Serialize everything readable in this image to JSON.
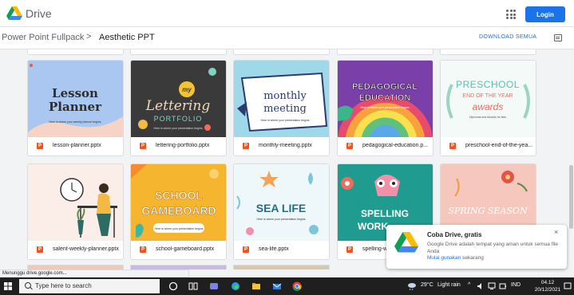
{
  "header": {
    "brand": "Drive",
    "login_label": "Login"
  },
  "breadcrumb": {
    "parent": "Power Point Fullpack",
    "separator": ">",
    "current": "Aesthetic PPT",
    "download_all": "DOWNLOAD SEMUA"
  },
  "files": [
    {
      "name": "lesson-planner.pptx",
      "thumb": {
        "title": [
          "Lesson",
          "Planner"
        ],
        "sub": "Here is where your weekly planner begins"
      }
    },
    {
      "name": "lettering-portfolio.pptx",
      "thumb": {
        "badge": "my",
        "title": [
          "Lettering"
        ],
        "sub2": "PORTFOLIO",
        "sub": "Here is where your presentation begins"
      }
    },
    {
      "name": "monthly-meeting.pptx",
      "thumb": {
        "title": [
          "monthly",
          "meeting"
        ],
        "sub": "Here is where your presentation begins"
      }
    },
    {
      "name": "pedagogical-education.p...",
      "thumb": {
        "title": [
          "PEDAGOGICAL",
          "EDUCATION"
        ],
        "sub": "Here is where your presentation begins"
      }
    },
    {
      "name": "preschool-end-of-the-yea...",
      "thumb": {
        "title": [
          "PRESCHOOL",
          "END OF THE YEAR",
          "awards"
        ],
        "sub": "Diplomas and Awards for kids"
      }
    },
    {
      "name": "salent-weekly-planner.pptx",
      "thumb": {}
    },
    {
      "name": "school-gameboard.pptx",
      "thumb": {
        "title": [
          "SCHOOL",
          "GAMEBOARD"
        ],
        "sub": "Here is where your presentation begins"
      }
    },
    {
      "name": "sea-life.pptx",
      "thumb": {
        "title": [
          "SEA LIFE"
        ],
        "sub": "Here is where your presentation begins"
      }
    },
    {
      "name": "spelling-w...",
      "thumb": {
        "title": [
          "SPELLING",
          "WORK"
        ]
      }
    },
    {
      "name": "",
      "thumb": {
        "title": [
          "SPRING SEASON"
        ]
      }
    }
  ],
  "file_icon_letter": "P",
  "toast": {
    "title": "Coba Drive, gratis",
    "body": "Google Drive adalah tempat yang aman untuk semua file Anda",
    "link": "Mulai gunakan",
    "link_tail": " sekarang",
    "close": "×"
  },
  "status_text": "Menunggu drive.google.com...",
  "taskbar": {
    "search_placeholder": "Type here to search",
    "temperature": "29°C",
    "weather": "Light rain",
    "language": "IND",
    "time": "04.12",
    "date": "20/12/2021"
  },
  "colors": {
    "accent": "#1a73e8",
    "file_icon": "#f4511e"
  }
}
